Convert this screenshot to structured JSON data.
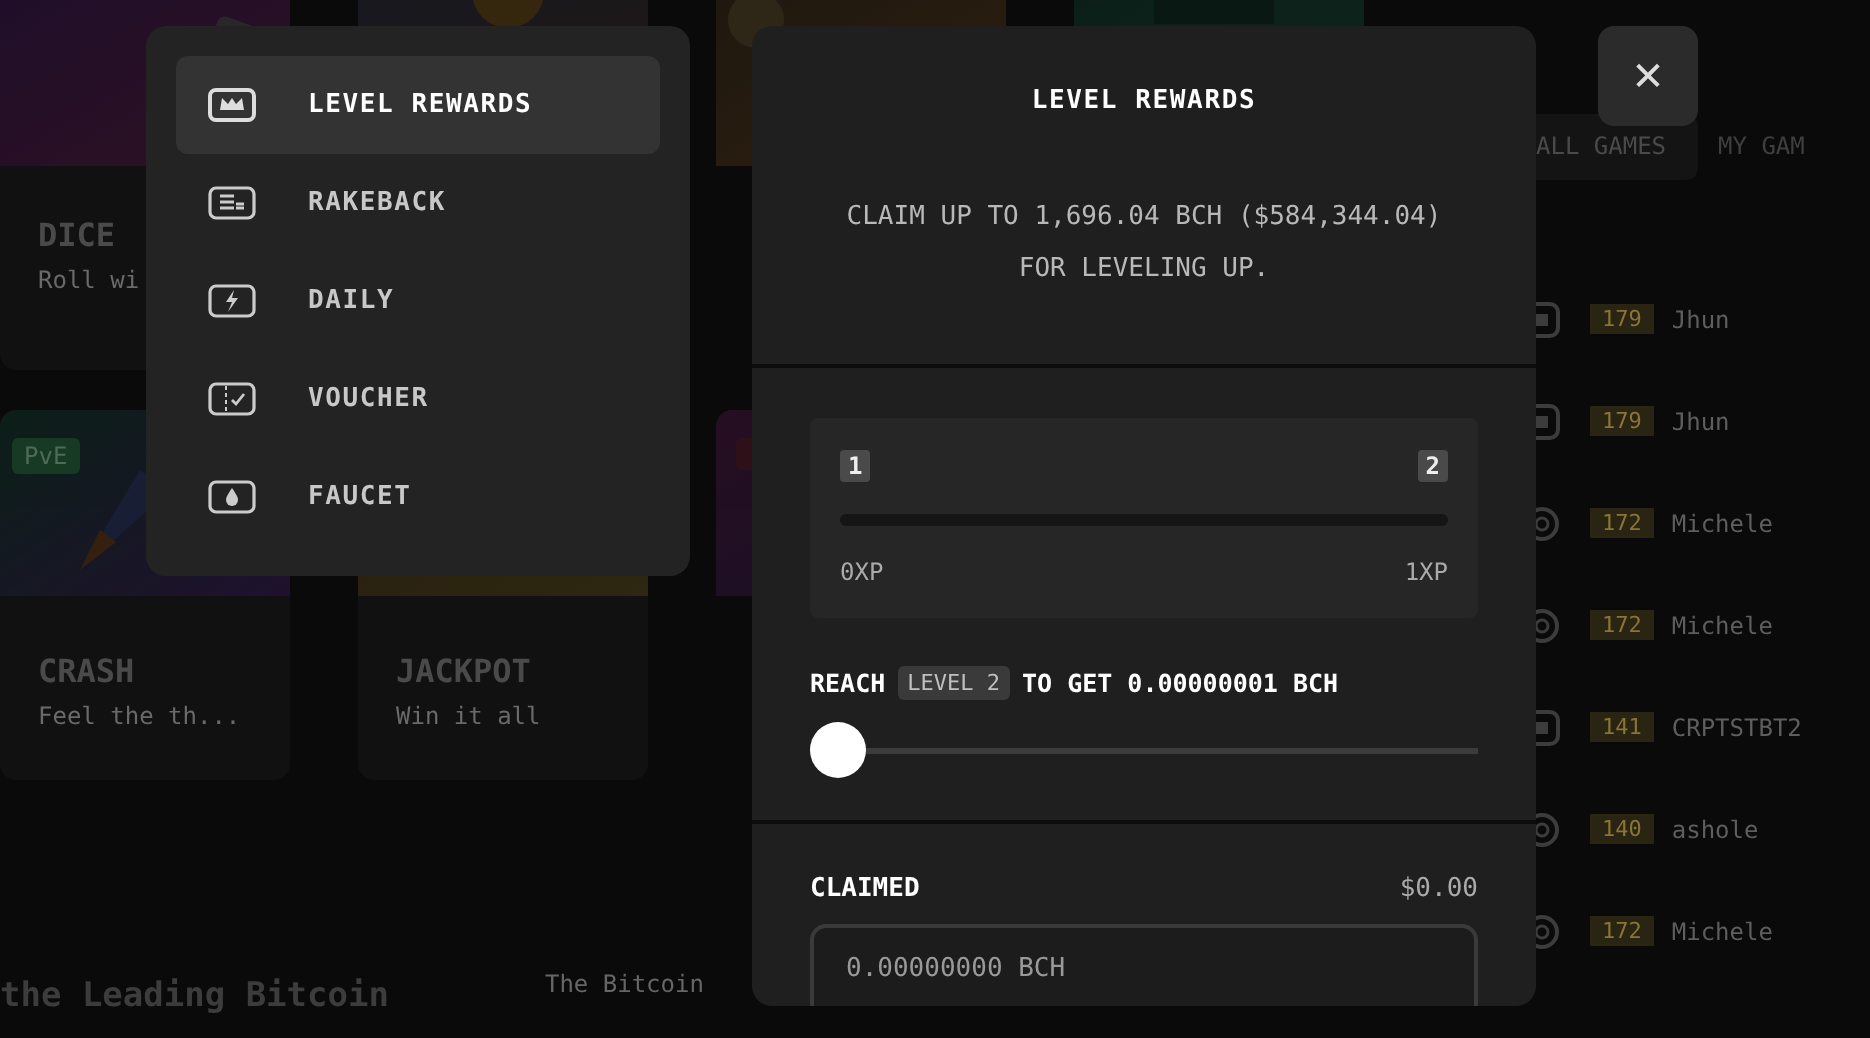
{
  "games": {
    "cards": [
      {
        "kind": "picture",
        "title": "DICE",
        "subtitle": "Roll wi"
      },
      {
        "kind": "picture"
      },
      {
        "kind": "picture"
      },
      {
        "kind": "picture"
      },
      {
        "kind": "picture",
        "badge": "PvE",
        "title": "CRASH",
        "subtitle": "Feel the th..."
      },
      {
        "kind": "picture",
        "title": "JACKPOT",
        "subtitle": "Win it all"
      },
      {
        "kind": "picture"
      }
    ],
    "headline": "the Leading Bitcoin",
    "intro": "The Bitcoin"
  },
  "activity": {
    "tabs": [
      {
        "label": "ALL GAMES",
        "selected": true
      },
      {
        "label": "MY GAM",
        "selected": false
      }
    ],
    "rows": [
      {
        "kind": "dice",
        "level": "179",
        "name": "Jhun"
      },
      {
        "kind": "dice",
        "level": "179",
        "name": "Jhun"
      },
      {
        "kind": "coin",
        "level": "172",
        "name": "Michele"
      },
      {
        "kind": "coin",
        "level": "172",
        "name": "Michele"
      },
      {
        "kind": "dice",
        "level": "141",
        "name": "CRPTSTBT2"
      },
      {
        "kind": "coin",
        "level": "140",
        "name": "ashole"
      },
      {
        "kind": "coin",
        "level": "172",
        "name": "Michele"
      }
    ]
  },
  "menu": {
    "items": [
      {
        "kind": "crown",
        "label": "LEVEL REWARDS",
        "selected": true
      },
      {
        "kind": "rakeback",
        "label": "RAKEBACK",
        "selected": false
      },
      {
        "kind": "bolt",
        "label": "DAILY",
        "selected": false
      },
      {
        "kind": "voucher",
        "label": "VOUCHER",
        "selected": false
      },
      {
        "kind": "drop",
        "label": "FAUCET",
        "selected": false
      }
    ]
  },
  "modal": {
    "title": "LEVEL REWARDS",
    "description": [
      "CLAIM UP TO 1,696.04 BCH ($584,344.04)",
      "FOR LEVELING UP."
    ],
    "progress": {
      "from_level": "1",
      "to_level": "2",
      "from_xp": "0XP",
      "to_xp": "1XP",
      "level": 0
    },
    "reach": {
      "prefix": "REACH",
      "chip": "LEVEL 2",
      "suffix": "TO GET 0.00000001 BCH"
    },
    "slider": {
      "level": 0
    },
    "claimed": {
      "label": "CLAIMED",
      "amount": "$0.00",
      "value": "0.00000000 BCH"
    }
  },
  "close_button": {
    "glyph": "✕"
  }
}
